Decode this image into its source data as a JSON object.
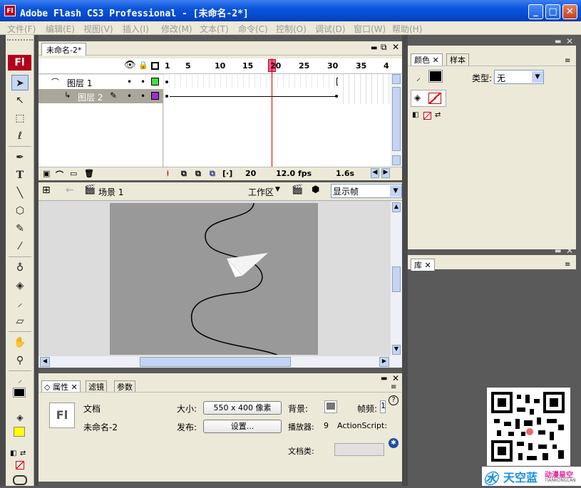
{
  "window": {
    "title": "Adobe Flash CS3 Professional - [未命名-2*]",
    "logo": "Fl",
    "min": "_",
    "max": "□",
    "close": "✕"
  },
  "menu": [
    "文件(F)",
    "编辑(E)",
    "视图(V)",
    "插入(I)",
    "修改(M)",
    "文本(T)",
    "命令(C)",
    "控制(O)",
    "调试(D)",
    "窗口(W)",
    "帮助(H)"
  ],
  "tools": {
    "logo": "Fl"
  },
  "timeline": {
    "doc_tab": "未命名-2*",
    "frame_numbers": [
      "1",
      "5",
      "10",
      "15",
      "20",
      "25",
      "30",
      "35",
      "4"
    ],
    "layers": [
      {
        "name": "图层 1",
        "selected": false
      },
      {
        "name": "图层 2",
        "selected": true
      }
    ],
    "footer": {
      "frame": "20",
      "fps": "12.0 fps",
      "time": "1.6s"
    }
  },
  "editbar": {
    "scene": "场景 1",
    "workspace": "工作区",
    "zoom": "显示帧"
  },
  "properties": {
    "tabs": [
      "属性",
      "滤镜",
      "参数"
    ],
    "doc_type": "文档",
    "doc_name": "未命名-2",
    "size_label": "大小:",
    "size_value": "550 x 400 像素",
    "publish_label": "发布:",
    "settings_button": "设置...",
    "bg_label": "背景:",
    "fps_label": "帧频:",
    "fps_value": "1",
    "player_label": "播放器:",
    "player_value": "9",
    "actionscript_label": "ActionScript:",
    "doc_class_label": "文档类:"
  },
  "color_panel": {
    "tabs": [
      "颜色",
      "样本"
    ],
    "type_label": "类型:",
    "type_value": "无"
  },
  "library": {
    "tab": "库"
  },
  "watermark": {
    "brand": "天空蓝",
    "subtitle": "动漫星空",
    "small": "TIANKONGLAN"
  },
  "colors": {
    "titlebar": "#0a55dc",
    "stage": "#999999",
    "layer1": "#44dd44",
    "layer2": "#9933cc",
    "playhead": "#cc0000",
    "fill": "#ffff00"
  }
}
